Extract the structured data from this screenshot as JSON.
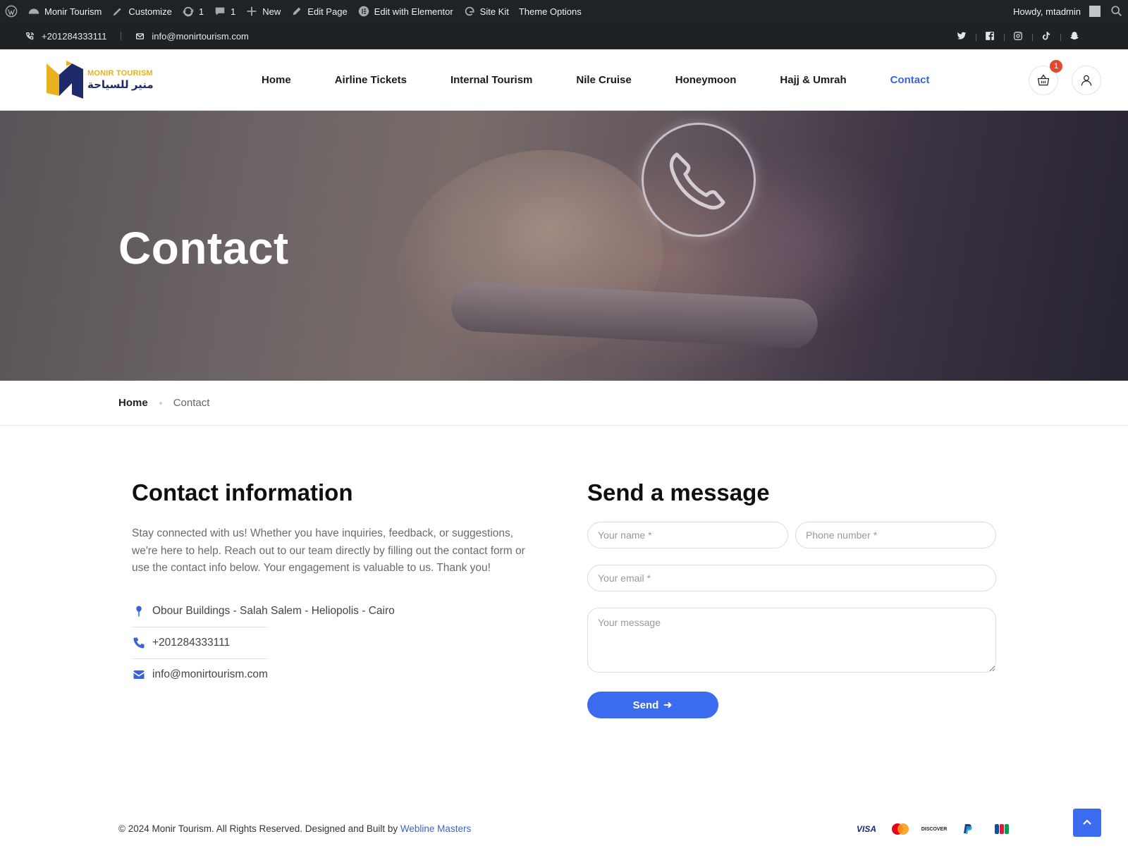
{
  "adminbar": {
    "site_name": "Monir Tourism",
    "customize": "Customize",
    "updates_count": "1",
    "comments_count": "1",
    "new": "New",
    "edit_page": "Edit Page",
    "edit_elementor": "Edit with Elementor",
    "site_kit": "Site Kit",
    "theme_options": "Theme Options",
    "howdy": "Howdy, mtadmin"
  },
  "topbar": {
    "phone": "+201284333111",
    "email": "info@monirtourism.com",
    "social_icons": [
      "twitter-icon",
      "facebook-icon",
      "instagram-icon",
      "tiktok-icon",
      "snapchat-icon"
    ]
  },
  "header": {
    "logo_en": "MONIR TOURISM",
    "logo_ar": "منير للسياحة",
    "nav": [
      {
        "label": "Home"
      },
      {
        "label": "Airline Tickets"
      },
      {
        "label": "Internal Tourism"
      },
      {
        "label": "Nile Cruise"
      },
      {
        "label": "Honeymoon"
      },
      {
        "label": "Hajj & Umrah"
      },
      {
        "label": "Contact"
      }
    ],
    "cart_count": "1"
  },
  "hero": {
    "title": "Contact"
  },
  "breadcrumb": {
    "home": "Home",
    "current": "Contact"
  },
  "contact_info": {
    "title": "Contact information",
    "description": "Stay connected with us! Whether you have inquiries, feedback, or suggestions, we're here to help. Reach out to our team directly by filling out the contact form or use the contact info below. Your engagement is valuable to us. Thank you!",
    "address": "Obour Buildings - Salah Salem - Heliopolis - Cairo",
    "phone": "+201284333111",
    "email": "info@monirtourism.com"
  },
  "form": {
    "title": "Send a message",
    "name_placeholder": "Your name *",
    "phone_placeholder": "Phone number *",
    "email_placeholder": "Your email *",
    "message_placeholder": "Your message",
    "send_label": "Send"
  },
  "footer": {
    "copyright": "© 2024 Monir Tourism. All Rights Reserved. Designed and Built by",
    "credit_link": "Webline Masters",
    "payment_visa": "VISA",
    "payment_discover": "DISCOVER"
  },
  "colors": {
    "accent": "#3b6cf0",
    "nav_active": "#3a63d9",
    "admin_bar": "#1d2327",
    "badge": "#e3472d",
    "logo_gold": "#e9b120",
    "logo_navy": "#1f2a6b"
  }
}
